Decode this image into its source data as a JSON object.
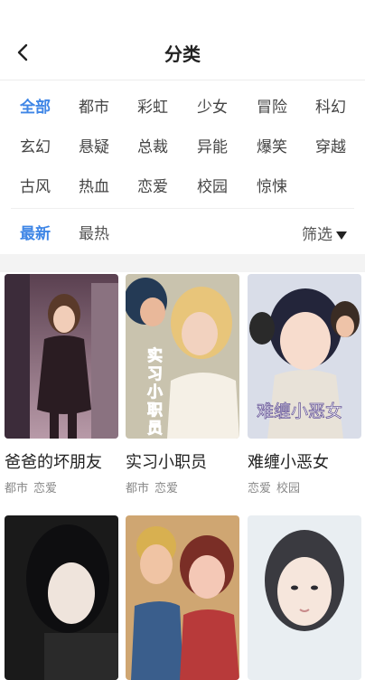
{
  "header": {
    "title": "分类"
  },
  "categories": [
    [
      "全部",
      "都市",
      "彩虹",
      "少女",
      "冒险",
      "科幻"
    ],
    [
      "玄幻",
      "悬疑",
      "总裁",
      "异能",
      "爆笑",
      "穿越"
    ],
    [
      "古风",
      "热血",
      "恋爱",
      "校园",
      "惊悚"
    ]
  ],
  "active_category": "全部",
  "sort": {
    "options": [
      "最新",
      "最热"
    ],
    "active": "最新",
    "filter_label": "筛选"
  },
  "comics": [
    {
      "title": "爸爸的坏朋友",
      "tags": [
        "都市",
        "恋爱"
      ]
    },
    {
      "title": "实习小职员",
      "tags": [
        "都市",
        "恋爱"
      ],
      "cover_text": "实习小职员"
    },
    {
      "title": "难缠小恶女",
      "tags": [
        "恋爱",
        "校园"
      ],
      "cover_text": "难缠小恶女"
    },
    {
      "title": "",
      "tags": []
    },
    {
      "title": "",
      "tags": []
    },
    {
      "title": "",
      "tags": []
    }
  ],
  "colors": {
    "accent": "#3f86e6",
    "text": "#222222",
    "muted": "#8a8a8a"
  }
}
